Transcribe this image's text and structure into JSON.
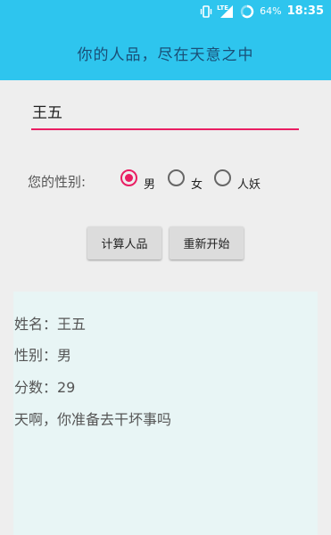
{
  "status_bar": {
    "network": "LTE",
    "battery": "64%",
    "time": "18:35"
  },
  "app_bar": {
    "title": "你的人品，尽在天意之中"
  },
  "form": {
    "name_value": "王五",
    "gender_label": "您的性别:",
    "genders": [
      {
        "label": "男",
        "checked": true
      },
      {
        "label": "女",
        "checked": false
      },
      {
        "label": "人妖",
        "checked": false
      }
    ],
    "calc_button": "计算人品",
    "reset_button": "重新开始"
  },
  "result": {
    "name_line": "姓名：王五",
    "gender_line": "性别：男",
    "score_line": "分数：29",
    "comment_line": "天啊，你准备去干坏事吗"
  },
  "colors": {
    "accent": "#e91e63",
    "bar": "#2ec5ee",
    "title_text": "#1a4f77",
    "result_bg": "#e8f5f5"
  }
}
